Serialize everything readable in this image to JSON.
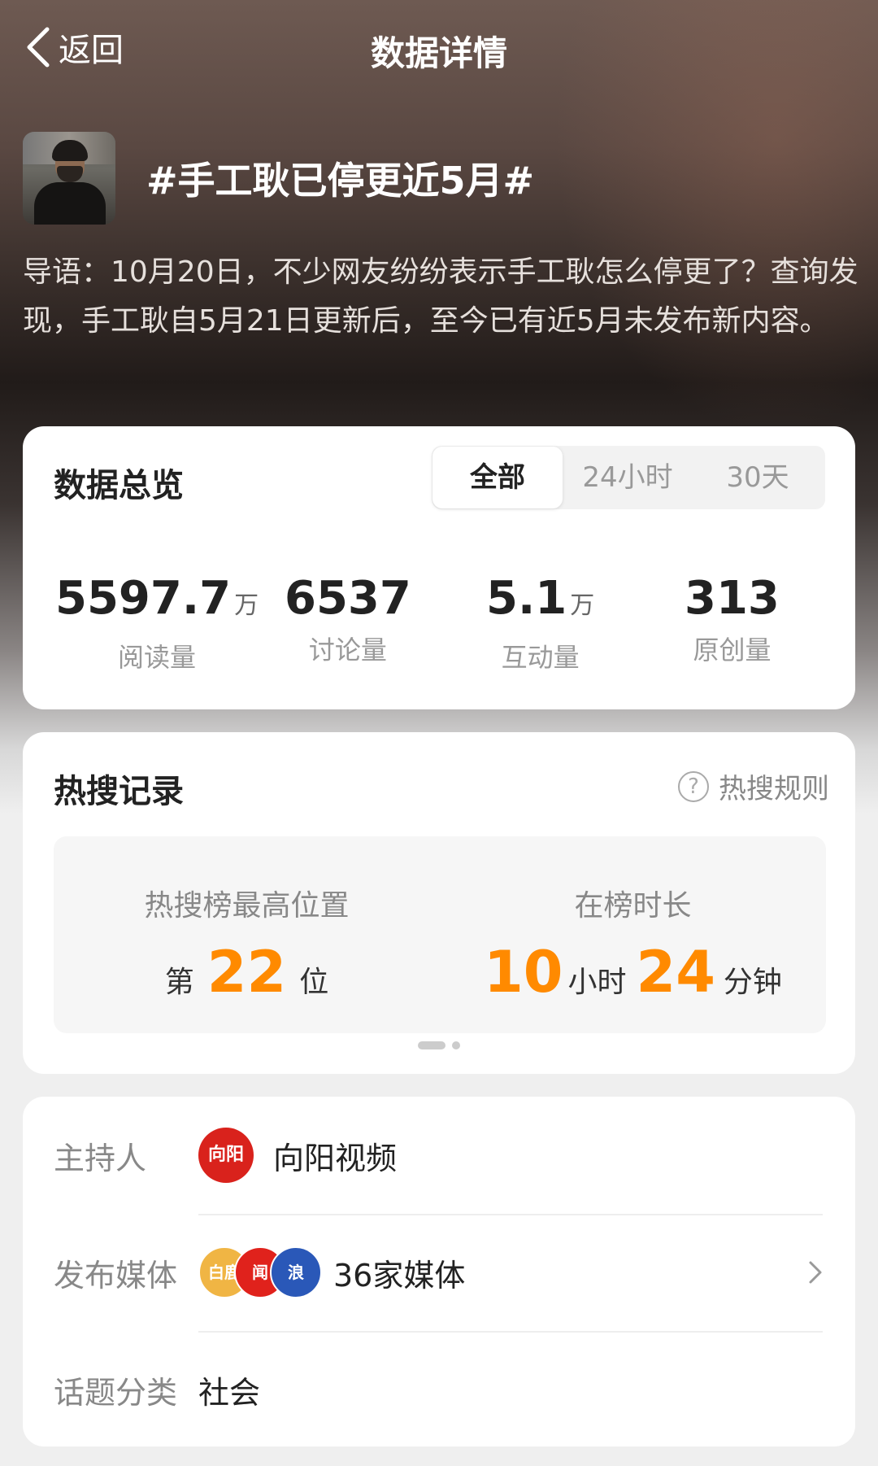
{
  "nav": {
    "back_label": "返回",
    "title": "数据详情"
  },
  "topic": {
    "title": "#手工耿已停更近5月#",
    "intro": "导语：10月20日，不少网友纷纷表示手工耿怎么停更了？查询发现，手工耿自5月21日更新后，至今已有近5月未发布新内容。"
  },
  "overview": {
    "title": "数据总览",
    "tabs": [
      "全部",
      "24小时",
      "30天"
    ],
    "active_tab": "全部",
    "stats": [
      {
        "value": "5597.7",
        "unit": "万",
        "label": "阅读量"
      },
      {
        "value": "6537",
        "unit": "",
        "label": "讨论量"
      },
      {
        "value": "5.1",
        "unit": "万",
        "label": "互动量"
      },
      {
        "value": "313",
        "unit": "",
        "label": "原创量"
      }
    ]
  },
  "hot": {
    "title": "热搜记录",
    "rules_label": "热搜规则",
    "rules_icon": "?",
    "peak_label": "热搜榜最高位置",
    "peak_prefix": "第",
    "peak_value": "22",
    "peak_suffix": "位",
    "duration_label": "在榜时长",
    "hours_value": "10",
    "hours_unit": "小时",
    "minutes_value": "24",
    "minutes_unit": "分钟",
    "accent_color": "#ff8a00"
  },
  "info": {
    "host_label": "主持人",
    "host_name": "向阳视频",
    "host_logo_text": "向阳",
    "media_label": "发布媒体",
    "media_value": "36家媒体",
    "media_logos": [
      "白鹿",
      "闻",
      "浪"
    ],
    "category_label": "话题分类",
    "category_value": "社会"
  }
}
